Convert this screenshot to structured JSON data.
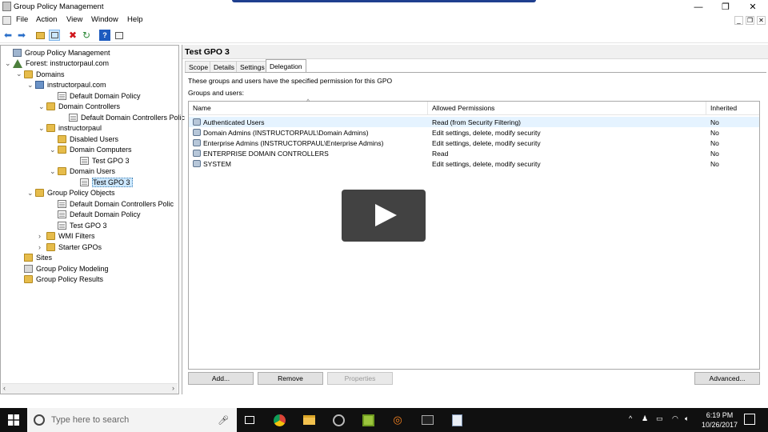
{
  "window": {
    "title": "Group Policy Management",
    "controls": {
      "minimize": "—",
      "restore": "❐",
      "close": "✕"
    }
  },
  "menu": {
    "items": [
      "File",
      "Action",
      "View",
      "Window",
      "Help"
    ],
    "inner_controls": {
      "minimize": "_",
      "restore": "❐",
      "close": "✕"
    }
  },
  "toolbar": {
    "icons": [
      "back-arrow-icon",
      "forward-arrow-icon",
      "folder-up-icon",
      "show-hide-tree-icon",
      "delete-icon",
      "refresh-icon",
      "help-icon",
      "properties-icon"
    ]
  },
  "tree": {
    "nodes": [
      {
        "label": "Group Policy Management",
        "icon": "gpm"
      },
      {
        "label": "Forest: instructorpaul.com",
        "icon": "forest",
        "expander": "⌄"
      },
      {
        "label": "Domains",
        "icon": "folder",
        "expander": "⌄"
      },
      {
        "label": "instructorpaul.com",
        "icon": "domain",
        "expander": "⌄"
      },
      {
        "label": "Default Domain Policy",
        "icon": "gpo"
      },
      {
        "label": "Domain Controllers",
        "icon": "folder",
        "expander": "⌄"
      },
      {
        "label": "Default Domain Controllers Polic",
        "icon": "gpo"
      },
      {
        "label": "instructorpaul",
        "icon": "folder",
        "expander": "⌄"
      },
      {
        "label": "Disabled Users",
        "icon": "folder"
      },
      {
        "label": "Domain Computers",
        "icon": "folder",
        "expander": "⌄"
      },
      {
        "label": "Test GPO 3",
        "icon": "gpo"
      },
      {
        "label": "Domain Users",
        "icon": "folder",
        "expander": "⌄"
      },
      {
        "label": "Test GPO 3",
        "icon": "gpo",
        "selected": true
      },
      {
        "label": "Group Policy Objects",
        "icon": "folder",
        "expander": "⌄"
      },
      {
        "label": "Default Domain Controllers Polic",
        "icon": "gpo"
      },
      {
        "label": "Default Domain Policy",
        "icon": "gpo"
      },
      {
        "label": "Test GPO 3",
        "icon": "gpo"
      },
      {
        "label": "WMI Filters",
        "icon": "folder",
        "expander": "›"
      },
      {
        "label": "Starter GPOs",
        "icon": "folder",
        "expander": "›"
      },
      {
        "label": "Sites",
        "icon": "sites"
      },
      {
        "label": "Group Policy Modeling",
        "icon": "modeling"
      },
      {
        "label": "Group Policy Results",
        "icon": "folder"
      }
    ]
  },
  "details": {
    "title": "Test GPO 3",
    "tabs": [
      "Scope",
      "Details",
      "Settings",
      "Delegation"
    ],
    "active_tab": "Delegation",
    "description": "These groups and users have the specified permission for this GPO",
    "groups_label": "Groups and users:",
    "columns": [
      "Name",
      "Allowed Permissions",
      "Inherited"
    ],
    "rows": [
      {
        "name": "Authenticated Users",
        "permissions": "Read (from Security Filtering)",
        "inherited": "No"
      },
      {
        "name": "Domain Admins (INSTRUCTORPAUL\\Domain Admins)",
        "permissions": "Edit settings, delete, modify security",
        "inherited": "No"
      },
      {
        "name": "Enterprise Admins (INSTRUCTORPAUL\\Enterprise Admins)",
        "permissions": "Edit settings, delete, modify security",
        "inherited": "No"
      },
      {
        "name": "ENTERPRISE DOMAIN CONTROLLERS",
        "permissions": "Read",
        "inherited": "No"
      },
      {
        "name": "SYSTEM",
        "permissions": "Edit settings, delete, modify security",
        "inherited": "No"
      }
    ],
    "buttons": {
      "add": "Add...",
      "remove": "Remove",
      "properties": "Properties",
      "advanced": "Advanced..."
    }
  },
  "taskbar": {
    "search_placeholder": "Type here to search",
    "time": "6:19 PM",
    "date": "10/26/2017"
  }
}
